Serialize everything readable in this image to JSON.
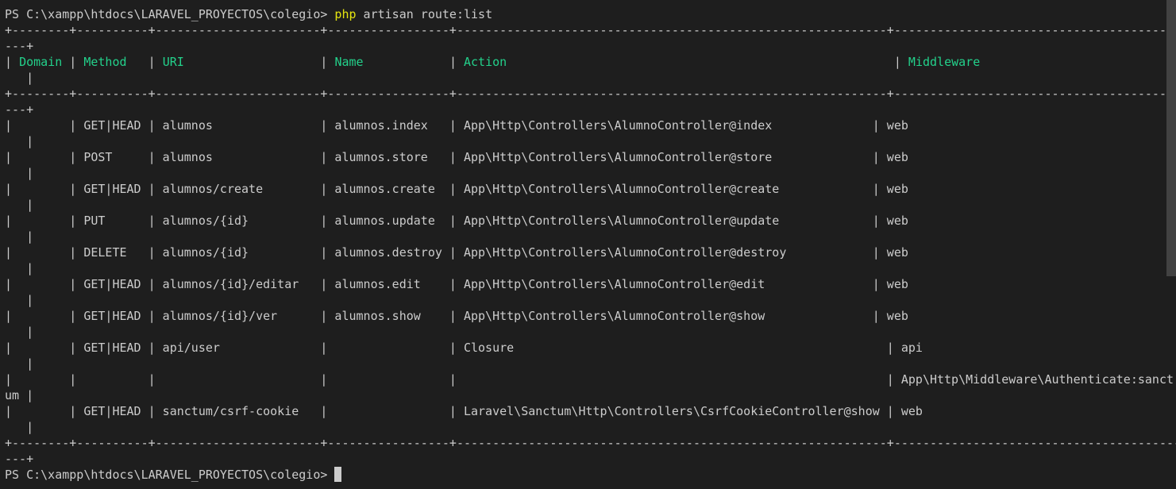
{
  "prompt": "PS C:\\xampp\\htdocs\\LARAVEL_PROYECTOS\\colegio> ",
  "command": {
    "program": "php",
    "args": " artisan route:list"
  },
  "table": {
    "border_top": "+--------+----------+-----------------------+-----------------+------------------------------------------------------------+-------------------------------------------",
    "border_wrap": "---+",
    "header": {
      "start": "| ",
      "columns": [
        {
          "text": "Domain",
          "pad": " ",
          "sep": "| "
        },
        {
          "text": "Method",
          "pad": "   ",
          "sep": "| "
        },
        {
          "text": "URI",
          "pad": "                   ",
          "sep": "| "
        },
        {
          "text": "Name",
          "pad": "            ",
          "sep": "| "
        },
        {
          "text": "Action",
          "pad": "                                                      ",
          "sep": "| "
        },
        {
          "text": "Middleware",
          "pad": "",
          "sep": ""
        }
      ],
      "wrap": "   |"
    },
    "rows": [
      {
        "text": "|        | GET|HEAD | alumnos               | alumnos.index   | App\\Http\\Controllers\\AlumnoController@index              | web",
        "wrap": "   |"
      },
      {
        "text": "|        | POST     | alumnos               | alumnos.store   | App\\Http\\Controllers\\AlumnoController@store              | web",
        "wrap": "   |"
      },
      {
        "text": "|        | GET|HEAD | alumnos/create        | alumnos.create  | App\\Http\\Controllers\\AlumnoController@create             | web",
        "wrap": "   |"
      },
      {
        "text": "|        | PUT      | alumnos/{id}          | alumnos.update  | App\\Http\\Controllers\\AlumnoController@update             | web",
        "wrap": "   |"
      },
      {
        "text": "|        | DELETE   | alumnos/{id}          | alumnos.destroy | App\\Http\\Controllers\\AlumnoController@destroy            | web",
        "wrap": "   |"
      },
      {
        "text": "|        | GET|HEAD | alumnos/{id}/editar   | alumnos.edit    | App\\Http\\Controllers\\AlumnoController@edit               | web",
        "wrap": "   |"
      },
      {
        "text": "|        | GET|HEAD | alumnos/{id}/ver      | alumnos.show    | App\\Http\\Controllers\\AlumnoController@show               | web",
        "wrap": "   |"
      },
      {
        "text": "|        | GET|HEAD | api/user              |                 | Closure                                                    | api",
        "wrap": "   |"
      },
      {
        "text": "|        |          |                       |                 |                                                            | App\\Http\\Middleware\\Authenticate:sanct",
        "wrap": "um |"
      },
      {
        "text": "|        | GET|HEAD | sanctum/csrf-cookie   |                 | Laravel\\Sanctum\\Http\\Controllers\\CsrfCookieController@show | web",
        "wrap": "   |"
      }
    ]
  }
}
